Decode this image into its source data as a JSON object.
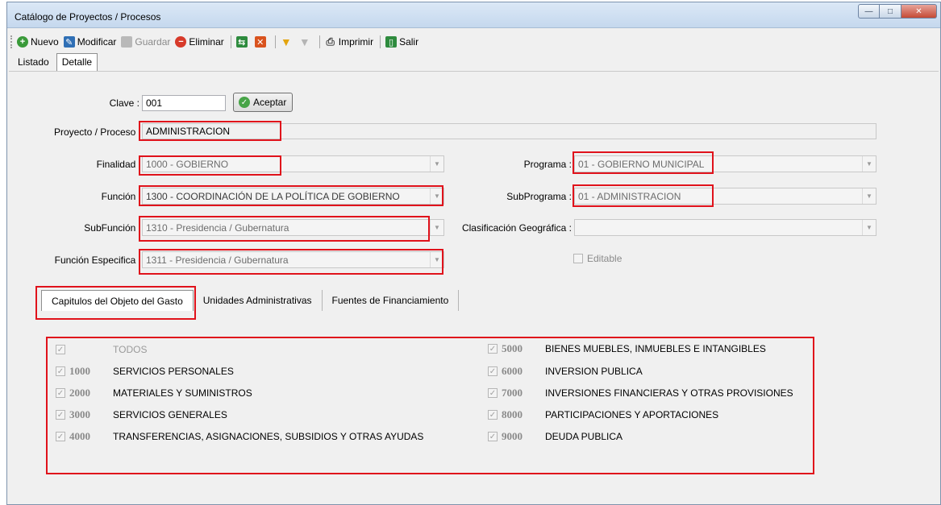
{
  "window": {
    "title": "Catálogo de Proyectos / Procesos",
    "buttons": {
      "minimize": "—",
      "maximize": "□",
      "close": "✕"
    }
  },
  "toolbar": {
    "nuevo": "Nuevo",
    "modificar": "Modificar",
    "guardar": "Guardar",
    "eliminar": "Eliminar",
    "imprimir": "Imprimir",
    "salir": "Salir"
  },
  "tabs": {
    "listado": "Listado",
    "detalle": "Detalle"
  },
  "form": {
    "clave_label": "Clave :",
    "clave_value": "001",
    "aceptar": "Aceptar",
    "proyecto_label": "Proyecto / Proceso :",
    "proyecto_value": "ADMINISTRACION",
    "finalidad_label": "Finalidad :",
    "finalidad_value": "1000 - GOBIERNO",
    "funcion_label": "Función :",
    "funcion_value": "1300 - COORDINACIÓN DE LA POLÍTICA DE GOBIERNO",
    "subfuncion_label": "SubFunción :",
    "subfuncion_value": "1310 - Presidencia / Gubernatura",
    "funcion_especifica_label": "Función Especifica :",
    "funcion_especifica_value": "1311 - Presidencia / Gubernatura",
    "programa_label": "Programa :",
    "programa_value": "01 - GOBIERNO MUNICIPAL",
    "subprograma_label": "SubPrograma :",
    "subprograma_value": "01 - ADMINISTRACION",
    "clasificacion_label": "Clasificación Geográfica :",
    "clasificacion_value": "",
    "editable_label": "Editable"
  },
  "inner_tabs": {
    "capitulos": "Capitulos del Objeto del Gasto",
    "unidades": "Unidades Administrativas",
    "fuentes": "Fuentes de Financiamiento"
  },
  "capitulos_left": [
    {
      "code": "",
      "name": "TODOS"
    },
    {
      "code": "1000",
      "name": "SERVICIOS PERSONALES"
    },
    {
      "code": "2000",
      "name": "MATERIALES Y SUMINISTROS"
    },
    {
      "code": "3000",
      "name": "SERVICIOS GENERALES"
    },
    {
      "code": "4000",
      "name": "TRANSFERENCIAS, ASIGNACIONES, SUBSIDIOS Y OTRAS AYUDAS"
    }
  ],
  "capitulos_right": [
    {
      "code": "5000",
      "name": "BIENES MUEBLES, INMUEBLES E INTANGIBLES"
    },
    {
      "code": "6000",
      "name": "INVERSION PUBLICA"
    },
    {
      "code": "7000",
      "name": "INVERSIONES FINANCIERAS Y OTRAS PROVISIONES"
    },
    {
      "code": "8000",
      "name": "PARTICIPACIONES Y APORTACIONES"
    },
    {
      "code": "9000",
      "name": "DEUDA PUBLICA"
    }
  ],
  "check_glyph": "✓",
  "colors": {
    "highlight": "#e0121b",
    "ok": "#47a447"
  }
}
